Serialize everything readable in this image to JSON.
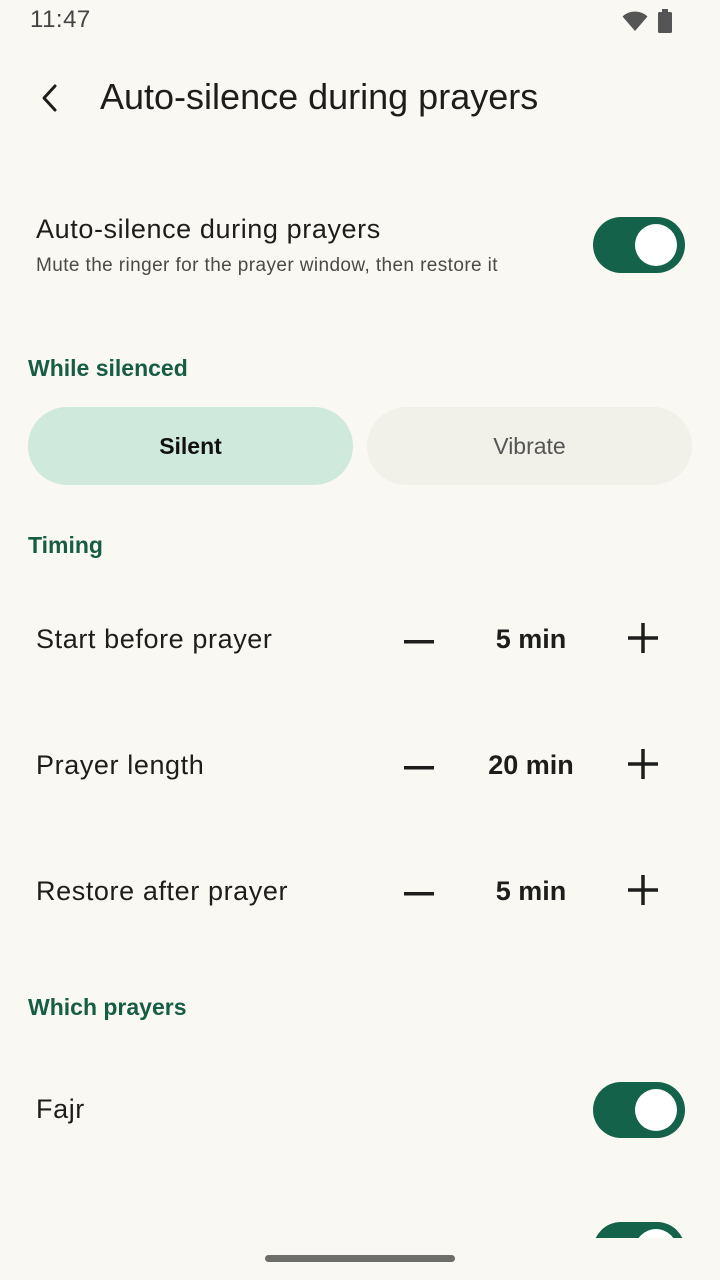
{
  "status_bar": {
    "time": "11:47",
    "icons": [
      "wifi-icon",
      "battery-icon"
    ]
  },
  "app_bar": {
    "back_icon": "chevron-left-icon",
    "title": "Auto-silence during prayers"
  },
  "master_toggle": {
    "title": "Auto-silence during prayers",
    "subtitle": "Mute the ringer for the prayer window, then restore it",
    "enabled": true
  },
  "while_silenced": {
    "header": "While silenced",
    "options": [
      {
        "label": "Silent",
        "selected": true
      },
      {
        "label": "Vibrate",
        "selected": false
      }
    ]
  },
  "timing": {
    "header": "Timing",
    "rows": [
      {
        "label": "Start before prayer",
        "value": "5 min"
      },
      {
        "label": "Prayer length",
        "value": "20 min"
      },
      {
        "label": "Restore after prayer",
        "value": "5 min"
      }
    ]
  },
  "which_prayers": {
    "header": "Which prayers",
    "items": [
      {
        "label": "Fajr",
        "enabled": true
      },
      {
        "label": "",
        "enabled": true
      }
    ]
  },
  "colors": {
    "accent": "#14624a",
    "header_text": "#175c45",
    "segment_selected": "#cfe9dd",
    "segment_unselected": "#f1f1ea",
    "background": "#faf8f3"
  }
}
